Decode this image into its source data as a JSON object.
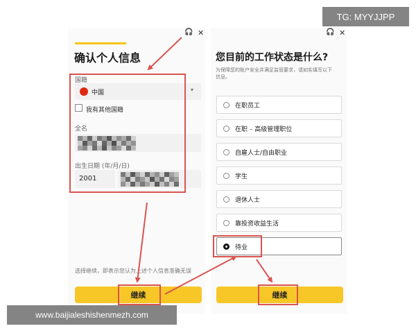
{
  "watermarks": {
    "tg": "TG: MYYJJPP",
    "url": "www.baijialeshishenmezh.com"
  },
  "left": {
    "title": "确认个人信息",
    "nationality_label": "国籍",
    "nationality_value": "中国",
    "other_nationality_label": "我有其他国籍",
    "fullname_label": "全名",
    "dob_label": "出生日期 (年/月/日)",
    "dob_year": "2001",
    "disclaimer": "选择继续，即表示您认为上述个人信息准确无误",
    "continue_label": "继续",
    "close_glyph": "✕",
    "support_glyph": "🎧"
  },
  "right": {
    "title": "您目前的工作状态是什么?",
    "subtitle_line1": "为保障您的账户安全并满足监管要求，请如实填写以下",
    "subtitle_line2": "信息。",
    "options": [
      "在职员工",
      "在职 – 高级管理职位",
      "自雇人士/自由职业",
      "学生",
      "退休人士",
      "靠投资收益生活",
      "待业"
    ],
    "selected_option": "待业",
    "continue_label": "继续",
    "close_glyph": "✕",
    "support_glyph": "🎧"
  },
  "colors": {
    "accent_yellow": "#f7c727",
    "annotation_red": "#d9534f",
    "flag_red": "#de2910"
  }
}
